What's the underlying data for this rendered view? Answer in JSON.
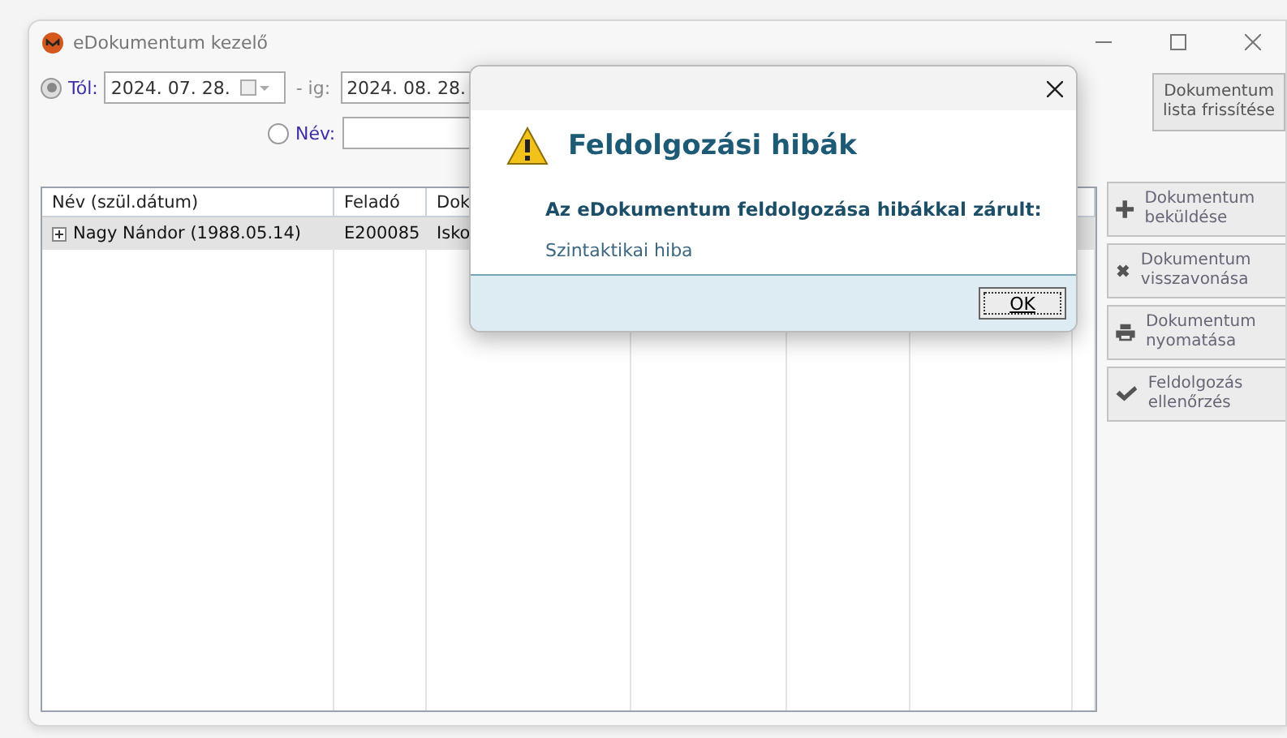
{
  "window": {
    "title": "eDokumentum kezelő"
  },
  "filters": {
    "from": {
      "label": "Tól:",
      "selected": true,
      "value": "2024. 07. 28."
    },
    "to": {
      "label": "- ig:",
      "value": "2024. 08. 28."
    },
    "name": {
      "label": "Név:",
      "selected": false
    }
  },
  "refresh_button": "Dokumentum lista frissítése",
  "table": {
    "columns": [
      "Név (szül.dátum)",
      "Feladó",
      "Dok"
    ],
    "rows": [
      {
        "cells": [
          "Nagy Nándor (1988.05.14)",
          "E200085",
          "Isko"
        ],
        "selected": true,
        "expanded": false
      }
    ]
  },
  "actions": [
    {
      "kind": "plus",
      "label": "Dokumentum beküldése"
    },
    {
      "kind": "cross",
      "label": "Dokumentum visszavonása"
    },
    {
      "kind": "printer",
      "label": "Dokumentum nyomatása"
    },
    {
      "kind": "check",
      "label": "Feldolgozás ellenőrzés"
    }
  ],
  "dialog": {
    "heading": "Feldolgozási hibák",
    "message": "Az eDokumentum feldolgozása hibákkal zárult:",
    "detail": "Szintaktikai hiba",
    "ok_button": "OK"
  }
}
